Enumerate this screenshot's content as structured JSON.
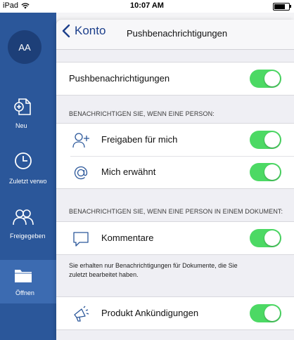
{
  "status": {
    "device": "iPad",
    "time": "10:07 AM"
  },
  "sidebar": {
    "avatar_initials": "AA",
    "items": [
      {
        "label": "Neu",
        "icon": "new-document-icon"
      },
      {
        "label": "Zuletzt verwo",
        "icon": "clock-icon"
      },
      {
        "label": "Freigegeben",
        "icon": "people-icon"
      },
      {
        "label": "Öffnen",
        "icon": "folder-icon"
      }
    ]
  },
  "modal": {
    "back_label": "Konto",
    "title": "Pushbenachrichtigungen",
    "main_toggle_label": "Pushbenachrichtigungen",
    "section1_header": "BENACHRICHTIGEN SIE, WENN EINE PERSON:",
    "section1_items": [
      {
        "label": "Freigaben für mich",
        "icon": "add-person-icon",
        "enabled": true
      },
      {
        "label": "Mich erwähnt",
        "icon": "at-sign-icon",
        "enabled": true
      }
    ],
    "section2_header": "BENACHRICHTIGEN SIE, WENN EINE PERSON IN EINEM DOKUMENT:",
    "section2_items": [
      {
        "label": "Kommentare",
        "icon": "comment-icon",
        "enabled": true
      }
    ],
    "section2_footer": "Sie erhalten nur Benachrichtigungen für Dokumente, die Sie zuletzt bearbeitet haben.",
    "section3_items": [
      {
        "label": "Produkt Ankündigungen",
        "icon": "megaphone-icon",
        "enabled": true
      }
    ],
    "toggle_color": "#4cd964"
  }
}
